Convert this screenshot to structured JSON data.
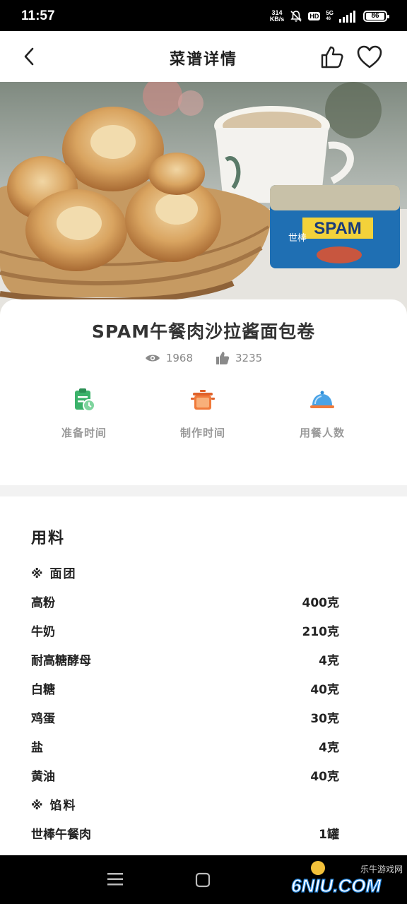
{
  "status_bar": {
    "time": "11:57",
    "net_speed_value": "314",
    "net_speed_unit": "KB/s",
    "hd_label": "HD",
    "signal_label_top": "5G",
    "signal_label_bottom": "46",
    "battery": "86"
  },
  "nav": {
    "title": "菜谱详情",
    "back_icon": "chevron-left-icon",
    "like_icon": "thumb-up-icon",
    "favorite_icon": "heart-icon"
  },
  "recipe": {
    "title": "SPAM午餐肉沙拉酱面包卷",
    "views": "1968",
    "likes": "3235",
    "meta": [
      {
        "label": "准备时间",
        "icon": "clipboard-clock-icon"
      },
      {
        "label": "制作时间",
        "icon": "pot-icon"
      },
      {
        "label": "用餐人数",
        "icon": "serving-cloche-icon"
      }
    ]
  },
  "ingredients": {
    "title": "用料",
    "group_dough": "※ 面团",
    "group_filling": "※ 馅料",
    "dough": [
      {
        "name": "高粉",
        "amount": "400克"
      },
      {
        "name": "牛奶",
        "amount": "210克"
      },
      {
        "name": "耐高糖酵母",
        "amount": "4克"
      },
      {
        "name": "白糖",
        "amount": "40克"
      },
      {
        "name": "鸡蛋",
        "amount": "30克"
      },
      {
        "name": "盐",
        "amount": "4克"
      },
      {
        "name": "黄油",
        "amount": "40克"
      }
    ],
    "filling": [
      {
        "name": "世棒午餐肉",
        "amount": "1罐"
      }
    ]
  },
  "hero": {
    "can_brand": "SPAM",
    "can_tag": "世棒"
  },
  "watermark": {
    "logo_text": "6NIU.COM",
    "site_name": "乐牛游戏网"
  },
  "colors": {
    "accent_green": "#3bb26a",
    "accent_orange": "#f07a3a",
    "accent_blue": "#2f8fd8",
    "muted_text": "#999999"
  }
}
